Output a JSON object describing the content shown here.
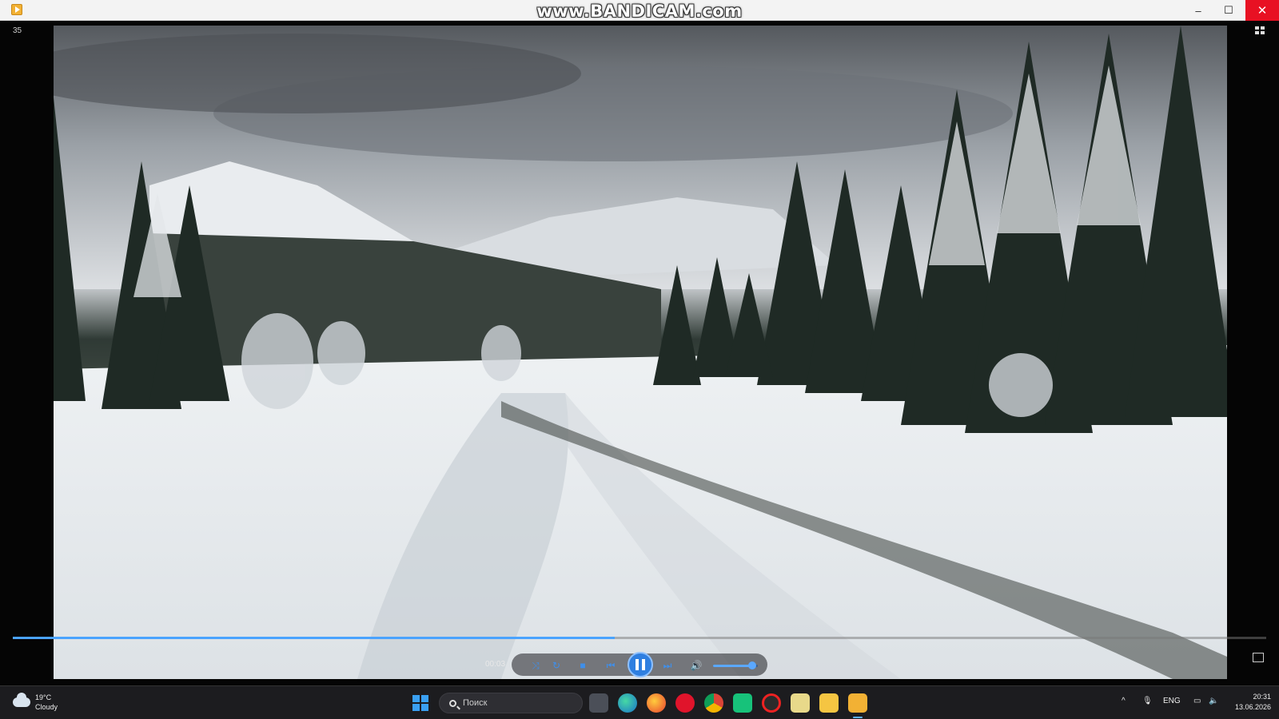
{
  "window": {
    "watermark": "www.BANDICAM.com",
    "fps_counter": "35",
    "minimize_glyph": "–",
    "maximize_glyph": "☐",
    "close_glyph": "✕"
  },
  "player": {
    "timecode": "00:03",
    "progress": 0.48,
    "volume": 0.88,
    "accent_color": "#2f7fe0",
    "controls": {
      "shuffle_glyph": "⤨",
      "repeat_glyph": "↻",
      "stop_glyph": "■",
      "prev_glyph": "⏮",
      "next_glyph": "⏭",
      "volume_glyph": "🔊"
    }
  },
  "taskbar": {
    "weather_temp": "19°C",
    "weather_desc": "Cloudy",
    "search_placeholder": "Поиск",
    "language": "ENG",
    "time": "20:31",
    "date": "13.06.2026",
    "apps": [
      "file-explorer-icon",
      "edge-icon",
      "firefox-icon",
      "opera-icon",
      "chrome-icon",
      "android-studio-icon",
      "record-icon",
      "notes-icon",
      "folder-icon",
      "media-player-icon"
    ]
  }
}
